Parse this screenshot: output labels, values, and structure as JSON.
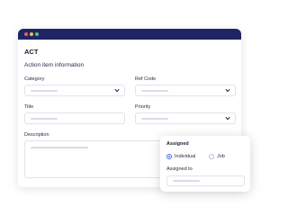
{
  "window": {
    "title": "ACT",
    "section_title": "Action item information"
  },
  "form": {
    "category_label": "Category",
    "ref_code_label": "Ref Code",
    "title_label": "Title",
    "priority_label": "Priority",
    "description_label": "Description"
  },
  "assigned_panel": {
    "heading": "Assigned",
    "options": [
      "Individual",
      "Job"
    ],
    "selected": "Individual",
    "assigned_to_label": "Assigned to"
  },
  "icons": {
    "dropdown": "chevron-down-icon",
    "window_controls": [
      "close-dot",
      "minimize-dot",
      "maximize-dot"
    ]
  },
  "colors": {
    "titlebar": "#1e2466",
    "accent": "#3d6fe0"
  }
}
